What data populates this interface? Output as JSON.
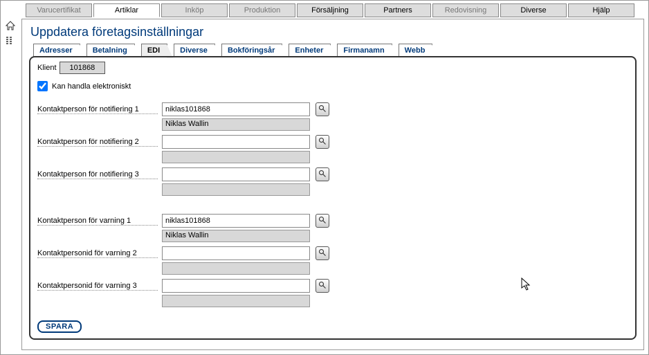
{
  "top_tabs": {
    "varucertifikat": "Varucertifikat",
    "artiklar": "Artiklar",
    "inkop": "Inköp",
    "produktion": "Produktion",
    "forsaljning": "Försäljning",
    "partners": "Partners",
    "redovisning": "Redovisning",
    "diverse": "Diverse",
    "hjalp": "Hjälp"
  },
  "page_title": "Uppdatera företagsinställningar",
  "inner_tabs": {
    "adresser": "Adresser",
    "betalning": "Betalning",
    "edi": "EDI",
    "diverse": "Diverse",
    "bokforingsar": "Bokföringsår",
    "enheter": "Enheter",
    "firmanamn": "Firmanamn",
    "webb": "Webb",
    "active": "EDI"
  },
  "klient": {
    "label": "Klient",
    "value": "101868"
  },
  "checkbox": {
    "checked": true,
    "label": "Kan handla elektroniskt"
  },
  "fields": {
    "notif1": {
      "label": "Kontaktperson för notifiering 1",
      "value": "niklas101868",
      "display": "Niklas Wallin"
    },
    "notif2": {
      "label": "Kontaktperson för notifiering 2",
      "value": "",
      "display": ""
    },
    "notif3": {
      "label": "Kontaktperson för notifiering 3",
      "value": "",
      "display": ""
    },
    "varn1": {
      "label": "Kontaktperson för varning 1",
      "value": "niklas101868",
      "display": "Niklas Wallin"
    },
    "varn2": {
      "label": "Kontaktpersonid för varning 2",
      "value": "",
      "display": ""
    },
    "varn3": {
      "label": "Kontaktpersonid för varning 3",
      "value": "",
      "display": ""
    }
  },
  "save_label": "SPARA"
}
